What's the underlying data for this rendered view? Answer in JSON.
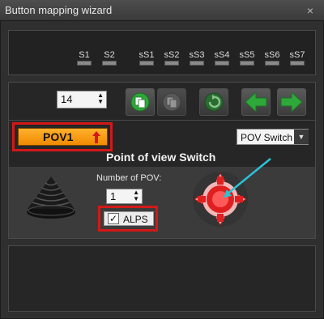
{
  "window": {
    "title": "Button mapping wizard",
    "close_glyph": "×"
  },
  "switches": [
    {
      "label": "S1"
    },
    {
      "label": "S2"
    },
    {
      "label": "sS1"
    },
    {
      "label": "sS2"
    },
    {
      "label": "sS3"
    },
    {
      "label": "sS4"
    },
    {
      "label": "sS5"
    },
    {
      "label": "sS6"
    },
    {
      "label": "sS7"
    }
  ],
  "toolbar": {
    "button_number": "14",
    "copy_icon": "copy-icon",
    "paste_icon": "paste-icon",
    "refresh_icon": "refresh-icon",
    "prev_icon": "arrow-left-icon",
    "next_icon": "arrow-right-icon"
  },
  "mapping": {
    "pov_button_label": "POV1",
    "type_select_value": "POV Switch",
    "section_title": "Point of view Switch",
    "number_of_pov_label": "Number of POV:",
    "number_of_pov_value": "1",
    "alps_label": "ALPS",
    "alps_checked": true
  },
  "colors": {
    "highlight": "#d31818",
    "pov_orange": "#f5a013",
    "toolbar_green": "#2fa83a",
    "pointer_cyan": "#29c3d6",
    "pov_red": "#e02020"
  }
}
